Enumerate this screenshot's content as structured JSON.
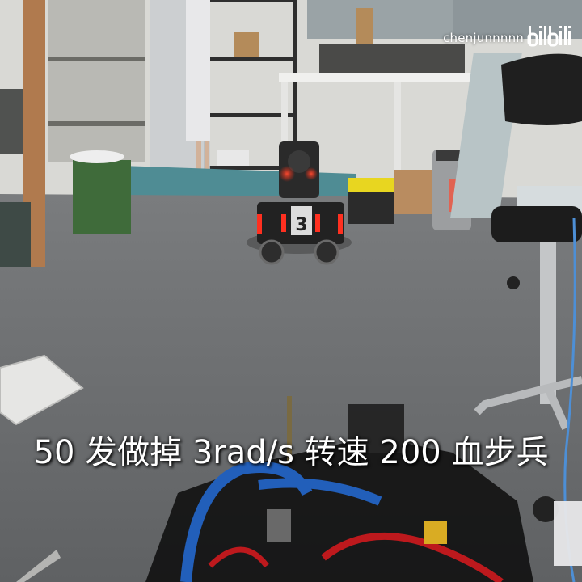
{
  "video": {
    "watermark": {
      "username": "chenjunnnnn",
      "platform_logo": "bilibili",
      "logo_icon": "bilibili-logo-icon"
    },
    "subtitle": "50 发做掉 3rad/s 转速 200 血步兵",
    "robot_number": "3"
  },
  "colors": {
    "floor": "#6f7173",
    "wall": "#d8d8d4",
    "robot_light": "#ff3020",
    "toolbox_yellow": "#e8d620",
    "stool_green": "#3f6b3a"
  }
}
